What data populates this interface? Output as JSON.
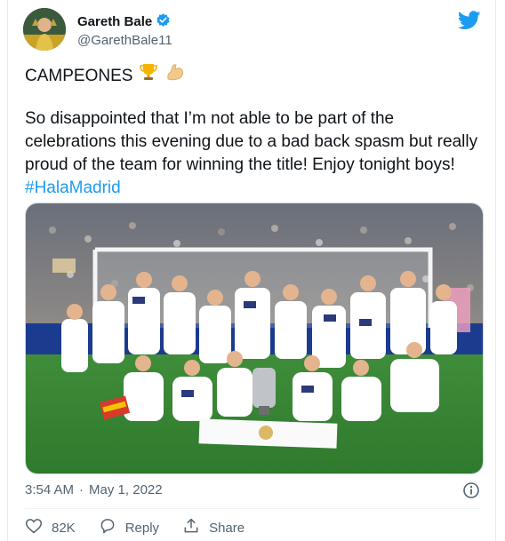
{
  "user": {
    "name": "Gareth Bale",
    "handle": "@GarethBale11"
  },
  "tweet": {
    "headline": "CAMPEONES",
    "text": "So disappointed that I’m not able to be part of the celebrations this evening due to a bad back spasm but really proud of the team for winning the title! Enjoy tonight boys!",
    "hashtag": "#HalaMadrid",
    "time": "3:54 AM",
    "separator": "·",
    "date": "May 1, 2022"
  },
  "actions": {
    "like_count": "82K",
    "reply_label": "Reply",
    "share_label": "Share"
  },
  "colors": {
    "accent": "#1d9bf0",
    "text": "#0f1419",
    "muted": "#536471"
  },
  "icons": [
    "twitter-bird-icon",
    "verified-badge-icon",
    "trophy-emoji",
    "flexed-biceps-emoji",
    "info-icon",
    "heart-icon",
    "reply-icon",
    "share-icon"
  ]
}
